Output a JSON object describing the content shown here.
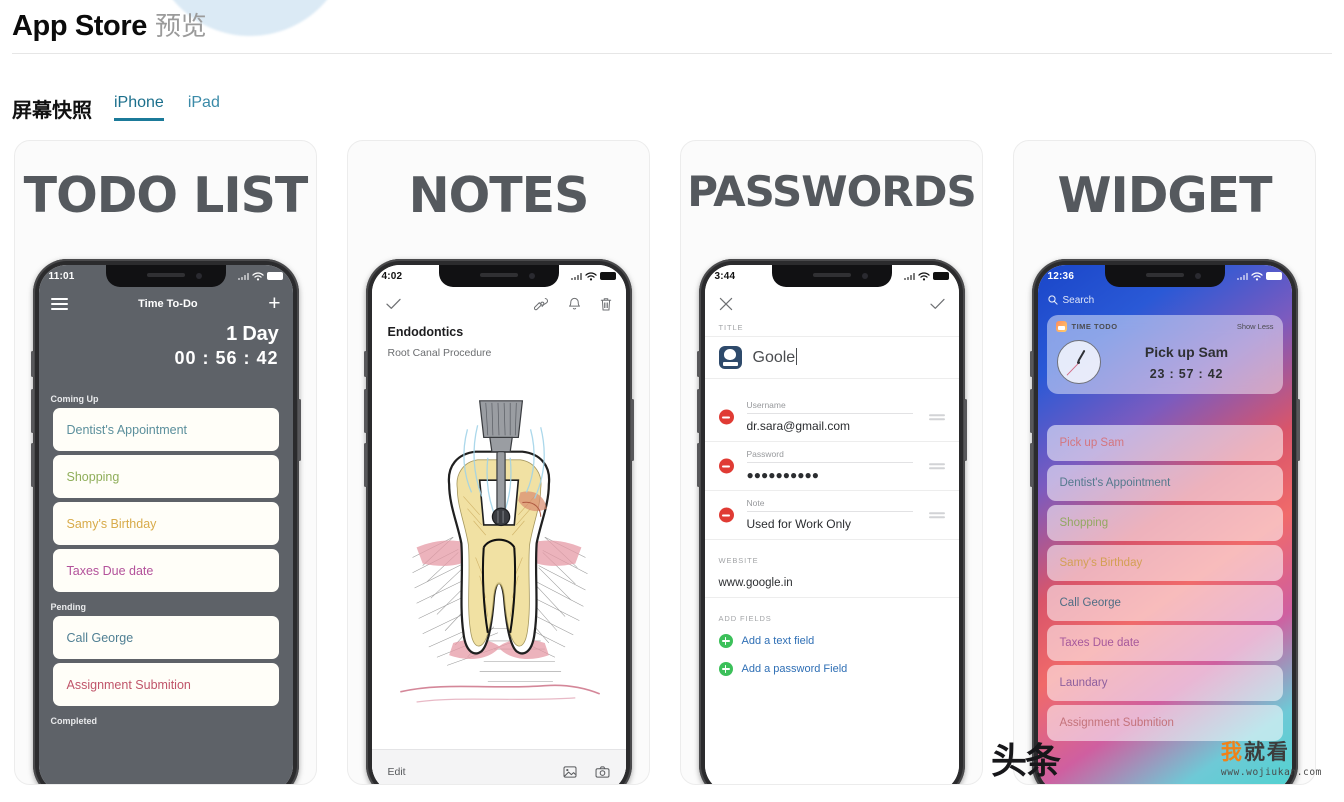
{
  "header": {
    "brand": "App Store",
    "brand_cn": "预览"
  },
  "section": {
    "title": "屏幕快照",
    "tabs": [
      {
        "label": "iPhone",
        "active": true
      },
      {
        "label": "iPad",
        "active": false
      }
    ]
  },
  "accent_color": "#1b7a99",
  "shots": [
    {
      "caption": "TODO LIST",
      "phone": {
        "status": {
          "time": "11:01"
        },
        "nav": {
          "title": "Time To-Do",
          "menu_icon": "hamburger-icon",
          "add_icon": "plus-icon"
        },
        "timer": {
          "days": "1 Day",
          "clock": "00 : 56 : 42"
        },
        "sections": [
          {
            "label": "Coming Up",
            "items": [
              {
                "text": "Dentist's Appointment",
                "color": "#5b8f9c"
              },
              {
                "text": "Shopping",
                "color": "#8fae5a"
              },
              {
                "text": "Samy's Birthday",
                "color": "#d8ab4a"
              },
              {
                "text": "Taxes Due date",
                "color": "#b3529b"
              }
            ]
          },
          {
            "label": "Pending",
            "items": [
              {
                "text": "Call George",
                "color": "#4f7f93"
              },
              {
                "text": "Assignment Submition",
                "color": "#c0556a"
              }
            ]
          },
          {
            "label": "Completed",
            "items": []
          }
        ]
      }
    },
    {
      "caption": "NOTES",
      "phone": {
        "status": {
          "time": "4:02"
        },
        "nav": {
          "done_icon": "check-icon",
          "icons": [
            "pen-draw-icon",
            "bell-icon",
            "trash-icon"
          ]
        },
        "note_title": "Endodontics",
        "note_subtitle": "Root Canal Procedure",
        "drawing_alt": "root-canal-tooth-illustration",
        "footer": {
          "edit_label": "Edit",
          "icons": [
            "photo-icon",
            "camera-icon"
          ]
        }
      }
    },
    {
      "caption": "PASSWORDS",
      "phone": {
        "status": {
          "time": "3:44"
        },
        "nav": {
          "close_icon": "close-icon",
          "save_icon": "check-icon"
        },
        "title_section_label": "TITLE",
        "title_value": "Goole",
        "title_icon": "password-app-icon",
        "fields": [
          {
            "label": "Username",
            "value": "dr.sara@gmail.com",
            "remove_icon": "minus-circle-icon",
            "drag_icon": "drag-handle-icon"
          },
          {
            "label": "Password",
            "value": "●●●●●●●●●●",
            "remove_icon": "minus-circle-icon",
            "drag_icon": "drag-handle-icon"
          },
          {
            "label": "Note",
            "value": "Used for Work Only",
            "remove_icon": "minus-circle-icon",
            "drag_icon": "drag-handle-icon"
          }
        ],
        "website_section_label": "WEBSITE",
        "website_value": "www.google.in",
        "add_section_label": "ADD FIELDS",
        "add_actions": [
          {
            "label": "Add a text field",
            "icon": "plus-circle-green-icon"
          },
          {
            "label": "Add a password Field",
            "icon": "plus-circle-green-icon"
          }
        ]
      }
    },
    {
      "caption": "WIDGET",
      "phone": {
        "status": {
          "time": "12:36"
        },
        "search_placeholder": "Search",
        "search_icon": "search-icon",
        "widget": {
          "app_name": "TIME TODO",
          "show_less": "Show Less",
          "app_icon": "time-todo-app-icon",
          "clock_icon": "analog-clock-icon",
          "task": "Pick up Sam",
          "countdown": "23 : 57 : 42"
        },
        "items": [
          {
            "text": "Pick up Sam",
            "color": "#d4757e"
          },
          {
            "text": "Dentist's Appointment",
            "color": "#54798d"
          },
          {
            "text": "Shopping",
            "color": "#93a861"
          },
          {
            "text": "Samy's Birthday",
            "color": "#d3a055"
          },
          {
            "text": "Call George",
            "color": "#4e6d84"
          },
          {
            "text": "Taxes Due date",
            "color": "#a6599c"
          },
          {
            "text": "Laundary",
            "color": "#8e5f9e"
          },
          {
            "text": "Assignment Submition",
            "color": "#c4737b"
          }
        ]
      }
    }
  ],
  "watermarks": {
    "toutiao": "头条",
    "site_cn_first": "我",
    "site_cn_rest": "就看",
    "site_url": "www.wojiukan.com"
  }
}
